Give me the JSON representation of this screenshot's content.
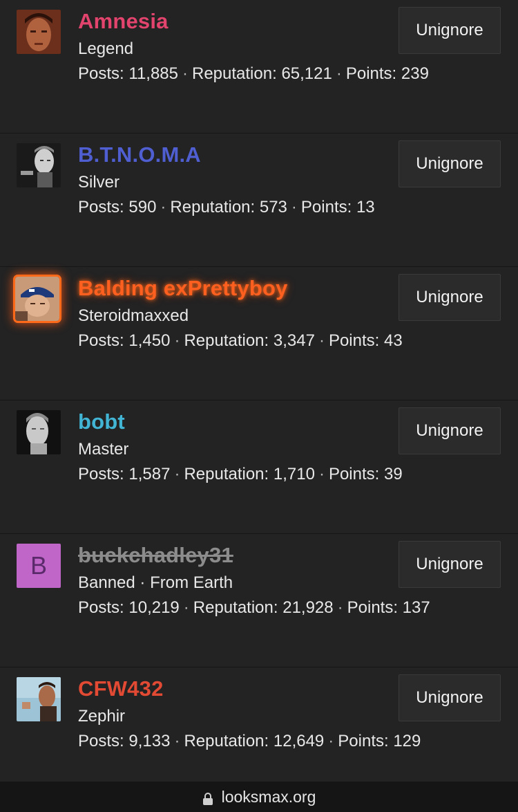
{
  "members": [
    {
      "username": "Amnesia",
      "name_color": "#e2446d",
      "user_title": "Legend",
      "posts_label": "Posts:",
      "posts": "11,885",
      "reputation_label": "Reputation:",
      "reputation": "65,121",
      "points_label": "Points:",
      "points": "239",
      "button_label": "Unignore",
      "avatar": "portrait-photo"
    },
    {
      "username": "B.T.N.O.M.A",
      "name_color": "#4f5fd1",
      "user_title": "Silver",
      "posts_label": "Posts:",
      "posts": "590",
      "reputation_label": "Reputation:",
      "reputation": "573",
      "points_label": "Points:",
      "points": "13",
      "button_label": "Unignore",
      "avatar": "bw-portrait-photo"
    },
    {
      "username": "Balding exPrettyboy",
      "name_color": "#ff5f1f",
      "user_title": "Steroidmaxxed",
      "posts_label": "Posts:",
      "posts": "1,450",
      "reputation_label": "Reputation:",
      "reputation": "3,347",
      "points_label": "Points:",
      "points": "43",
      "button_label": "Unignore",
      "avatar": "cap-portrait-photo"
    },
    {
      "username": "bobt",
      "name_color": "#42b4d4",
      "user_title": "Master",
      "posts_label": "Posts:",
      "posts": "1,587",
      "reputation_label": "Reputation:",
      "reputation": "1,710",
      "points_label": "Points:",
      "points": "39",
      "button_label": "Unignore",
      "avatar": "statue-photo"
    },
    {
      "username": "buckchadley31",
      "name_color": "#8c8c8c",
      "user_title": "Banned · From Earth",
      "posts_label": "Posts:",
      "posts": "10,219",
      "reputation_label": "Reputation:",
      "reputation": "21,928",
      "points_label": "Points:",
      "points": "137",
      "button_label": "Unignore",
      "avatar_letter": "B"
    },
    {
      "username": "CFW432",
      "name_color": "#e24a34",
      "user_title": "Zephir",
      "posts_label": "Posts:",
      "posts": "9,133",
      "reputation_label": "Reputation:",
      "reputation": "12,649",
      "points_label": "Points:",
      "points": "129",
      "button_label": "Unignore",
      "avatar": "profile-photo"
    }
  ],
  "separator": "·",
  "url_bar": {
    "domain": "looksmax.org",
    "icon": "lock-icon"
  }
}
